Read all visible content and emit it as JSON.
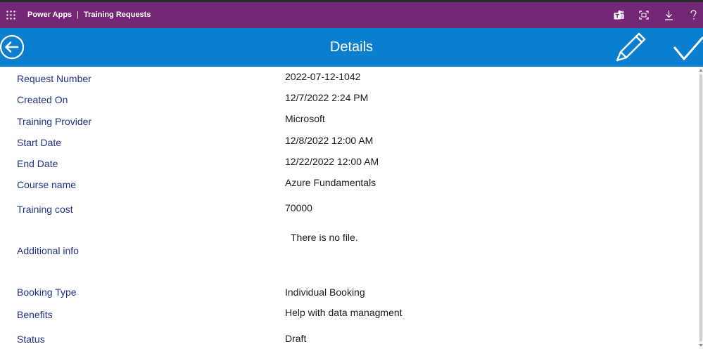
{
  "topbar": {
    "product": "Power Apps",
    "separator": "|",
    "app_title": "Training Requests",
    "icons": [
      "waffle-icon",
      "teams-icon",
      "fit-to-screen-icon",
      "download-icon",
      "help-icon"
    ]
  },
  "header": {
    "title": "Details",
    "icons": [
      "back-arrow-icon",
      "edit-pencil-icon",
      "checkmark-icon"
    ]
  },
  "form": {
    "fields": [
      {
        "label": "Request Number",
        "value": "2022-07-12-1042"
      },
      {
        "label": "Created On",
        "value": "12/7/2022 2:24 PM"
      },
      {
        "label": "Training Provider",
        "value": "Microsoft"
      },
      {
        "label": "Start Date",
        "value": "12/8/2022 12:00 AM"
      },
      {
        "label": "End Date",
        "value": "12/22/2022 12:00 AM"
      },
      {
        "label": "Course name",
        "value": "Azure Fundamentals"
      },
      {
        "label": "Training cost",
        "value": "70000"
      },
      {
        "label": "Additional info",
        "value": "There is no file."
      },
      {
        "label": "Booking Type",
        "value": "Individual Booking"
      },
      {
        "label": "Benefits",
        "value": "Help with data managment"
      },
      {
        "label": "Status",
        "value": "Draft"
      }
    ]
  },
  "colors": {
    "top_strip": "#2b2b2b",
    "topbar": "#742774",
    "header": "#0a7fd0",
    "label": "#1f3384",
    "value": "#1b1b1b",
    "background": "#ffffff"
  }
}
